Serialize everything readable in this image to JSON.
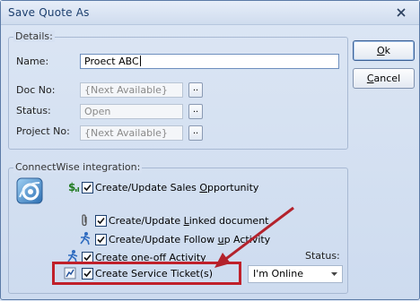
{
  "window": {
    "title": "Save Quote As"
  },
  "details": {
    "legend": "Details:",
    "name_label": "Name:",
    "name_value": "Proect ABC",
    "doc_no_label": "Doc No:",
    "doc_no_value": "{Next Available}",
    "status_label": "Status:",
    "status_value": "Open",
    "project_no_label": "Project No:",
    "project_no_value": "{Next Available}",
    "browse_label": ".."
  },
  "buttons": {
    "ok_label": "k",
    "ok_mnemonic": "O",
    "cancel_label": "ancel",
    "cancel_mnemonic": "C"
  },
  "connectwise": {
    "legend": "ConnectWise integration:",
    "logo_icon": "connectwise-logo-icon",
    "options": {
      "opportunity": {
        "pre": "Create/Update Sales ",
        "mn": "O",
        "post": "pportunity",
        "checked": true
      },
      "linked_doc": {
        "pre": "Create/Update ",
        "mn": "L",
        "post": "inked document",
        "checked": true
      },
      "follow_up": {
        "pre": "Create/Update Follow ",
        "mn": "u",
        "post": "p Activity",
        "checked": true
      },
      "one_off": {
        "pre": "Create one-",
        "mn": "o",
        "post": "ff Activity",
        "checked": true
      },
      "service_ticket": {
        "pre": "Create Service Ticket(s)",
        "checked": true
      }
    },
    "status_label": "Status:",
    "status_value": "I'm Online"
  },
  "colors": {
    "highlight": "#c0202a",
    "annotation_arrow": "#b3222c"
  }
}
